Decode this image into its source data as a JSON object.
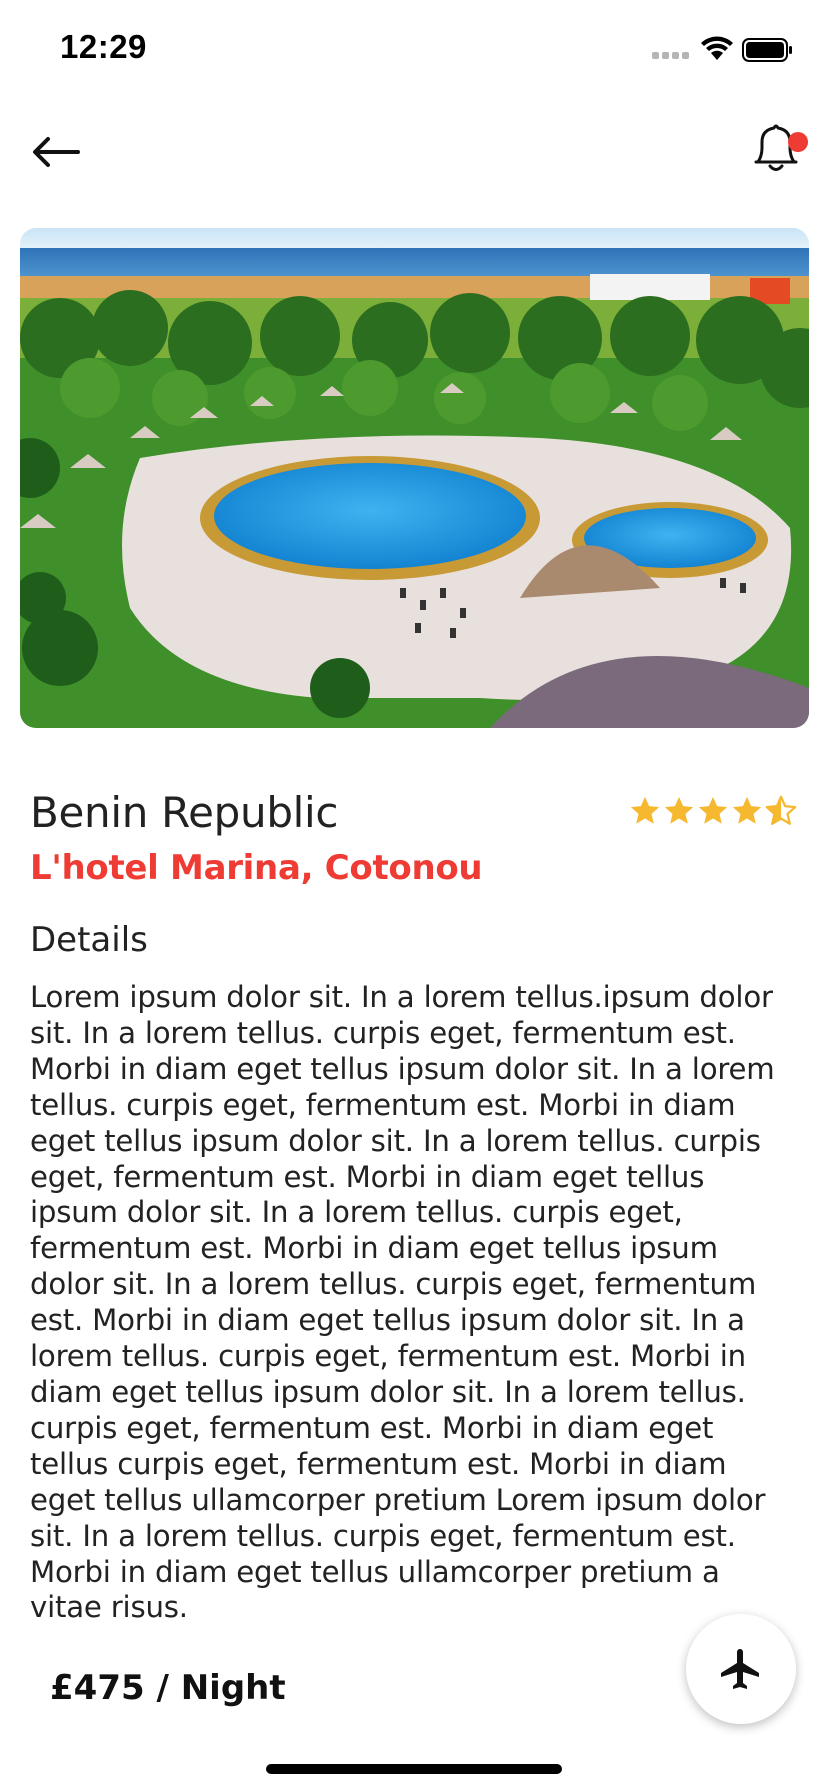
{
  "status_bar": {
    "time": "12:29",
    "icons": [
      "signal-icon",
      "wifi-icon",
      "battery-icon"
    ]
  },
  "header": {
    "back_icon": "arrow-left-icon",
    "notification_icon": "bell-icon",
    "has_notification": true
  },
  "hero": {
    "image": "resort-pool-photo"
  },
  "place": {
    "country": "Benin Republic",
    "hotel": "L'hotel Marina, Cotonou",
    "rating": 4.5,
    "rating_max": 5
  },
  "details": {
    "title": "Details",
    "body": "Lorem ipsum dolor sit. In a lorem tellus.ipsum dolor sit. In a lorem tellus. curpis eget, fermentum est. Morbi in diam eget tellus  ipsum dolor sit. In a lorem tellus. curpis eget, fermentum est. Morbi in diam eget tellus ipsum dolor sit. In a lorem tellus. curpis eget, fermentum est. Morbi in diam eget tellus ipsum dolor sit. In a lorem tellus. curpis eget, fermentum est. Morbi in diam eget tellus ipsum dolor sit. In a lorem tellus. curpis eget, fermentum est. Morbi in diam eget tellus ipsum dolor sit. In a lorem tellus. curpis eget, fermentum est. Morbi in diam eget tellus ipsum dolor sit. In a lorem tellus. curpis eget, fermentum est. Morbi in diam eget tellus curpis eget, fermentum est. Morbi in diam eget tellus ullamcorper pretium Lorem ipsum dolor sit. In a lorem tellus. curpis eget, fermentum est. Morbi in diam eget tellus ullamcorper pretium a vitae risus."
  },
  "booking": {
    "price": "£475 / Night",
    "fab_icon": "airplane-icon"
  },
  "colors": {
    "accent": "#ee3b34",
    "star": "#f5b82e",
    "text": "#222222"
  }
}
